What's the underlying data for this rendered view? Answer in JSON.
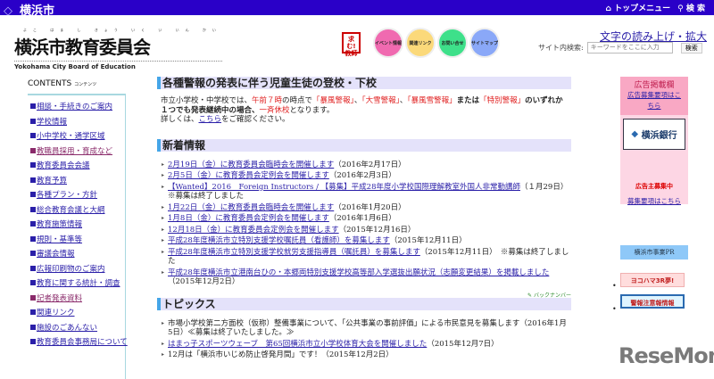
{
  "topbar": {
    "logo": "横浜市",
    "top_menu": "トップメニュー",
    "search": "検 索"
  },
  "brand": {
    "ruby": "よこ はま し きょう いく い いん かい",
    "title": "横浜市教育委員会",
    "english": "Yokohama City Board of Education"
  },
  "buttons": {
    "recruit": "求む!教師",
    "event": "イベント情報",
    "links": "関連リンク",
    "contact": "お問い合せ",
    "sitemap": "サイトマップ"
  },
  "read_aloud": "文字の読み上げ・拡大",
  "search": {
    "label": "サイト内検索:",
    "placeholder": "キーワードをここに入力",
    "button": "検索"
  },
  "sidebar": {
    "heading": "CONTENTS",
    "heading_sub": "コンテンツ",
    "items": [
      "相談・手続きのご案内",
      "学校情報",
      "小中学校・通学区域",
      "教職員採用・育成など",
      "教育委員会会議",
      "教育予算",
      "各種プラン・方針",
      "総合教育会議と大綱",
      "教育施策情報",
      "規則・基準等",
      "審議会情報",
      "広報印刷物のご案内",
      "教育に関する統計・調査",
      "記者発表資料",
      "関連リンク",
      "施設のごあんない",
      "教育委員会事務局について"
    ]
  },
  "alert": {
    "heading": "各種警報の発表に伴う児童生徒の登校・下校",
    "t1": "市立小学校・中学校では、",
    "t2": "午前７時",
    "t3": "の時点で",
    "t4": "「暴風警報」",
    "t5": "、",
    "t6": "「大雪警報」",
    "t7": "、",
    "t8": "「暴風雪警報」",
    "t9": "または",
    "t10": "「特別警報」",
    "t11": "のいずれか１つでも発表継続中の場合、",
    "t12": "一斉休校",
    "t13": "となります。",
    "t14": "詳しくは、",
    "link": "こちら",
    "t15": "をご確認ください。"
  },
  "news": {
    "heading": "新着情報",
    "items": [
      {
        "link": "2月19日（金）に教育委員会臨時会を開催します",
        "note": "（2016年2月17日）"
      },
      {
        "link": "2月5日（金）に教育委員会定例会を開催します",
        "note": "（2016年2月3日）"
      },
      {
        "link": "【Wanted】2016　Foreign Instructors / 【募集】平成28年度小学校国際理解教室外国人非常勤講師",
        "note": "（１月29日）※募集は終了しました"
      },
      {
        "link": "1月22日（金）に教育委員会臨時会を開催します",
        "note": "（2016年1月20日）"
      },
      {
        "link": "1月8日（金）に教育委員会定例会を開催します",
        "note": "（2016年1月6日）"
      },
      {
        "link": "12月18日（金）に教育委員会定例会を開催します",
        "note": "（2015年12月16日）"
      },
      {
        "link": "平成28年度横浜市立特別支援学校嘱託員（看護師）を募集します",
        "note": "（2015年12月11日）"
      },
      {
        "link": "平成28年度横浜市立特別支援学校就労支援指導員（嘱託員）を募集します",
        "note": "（2015年12月11日）　※募集は終了しました"
      },
      {
        "link": "平成28年度横浜市立港南台ひの・本郷両特別支援学校高等部入学選抜出願状況（志願変更結果）を掲載しました",
        "note": "（2015年12月2日）"
      }
    ],
    "back": "バックナンバー"
  },
  "topics": {
    "heading": "トピックス",
    "items": [
      {
        "link": "",
        "note": "市場小学校第二方面校（仮称）整備事業について、「公共事業の事前評価」による市民意見を募集します（2016年1月5日）≪募集は終了いたしました。≫"
      },
      {
        "link": "はまっ子スポーツウェーブ　第65回横浜市立小学校体育大会を開催しました",
        "note": "（2015年12月7日）"
      },
      {
        "link": "",
        "note": "12月は「横浜市いじめ防止啓発月間」です！（2015年12月2日）"
      }
    ]
  },
  "ads": {
    "title": "広告掲載欄",
    "recruit_link": "広告募集要項はこちら",
    "bank": "横浜銀行",
    "wanted": "広告主募集中",
    "wanted_link": "募集要項はこちら"
  },
  "pr": {
    "heading": "横浜市事業PR",
    "banner1": "ヨコハマ3R夢!",
    "banner2": "警報注意報情報"
  },
  "watermark": "ReseMom"
}
